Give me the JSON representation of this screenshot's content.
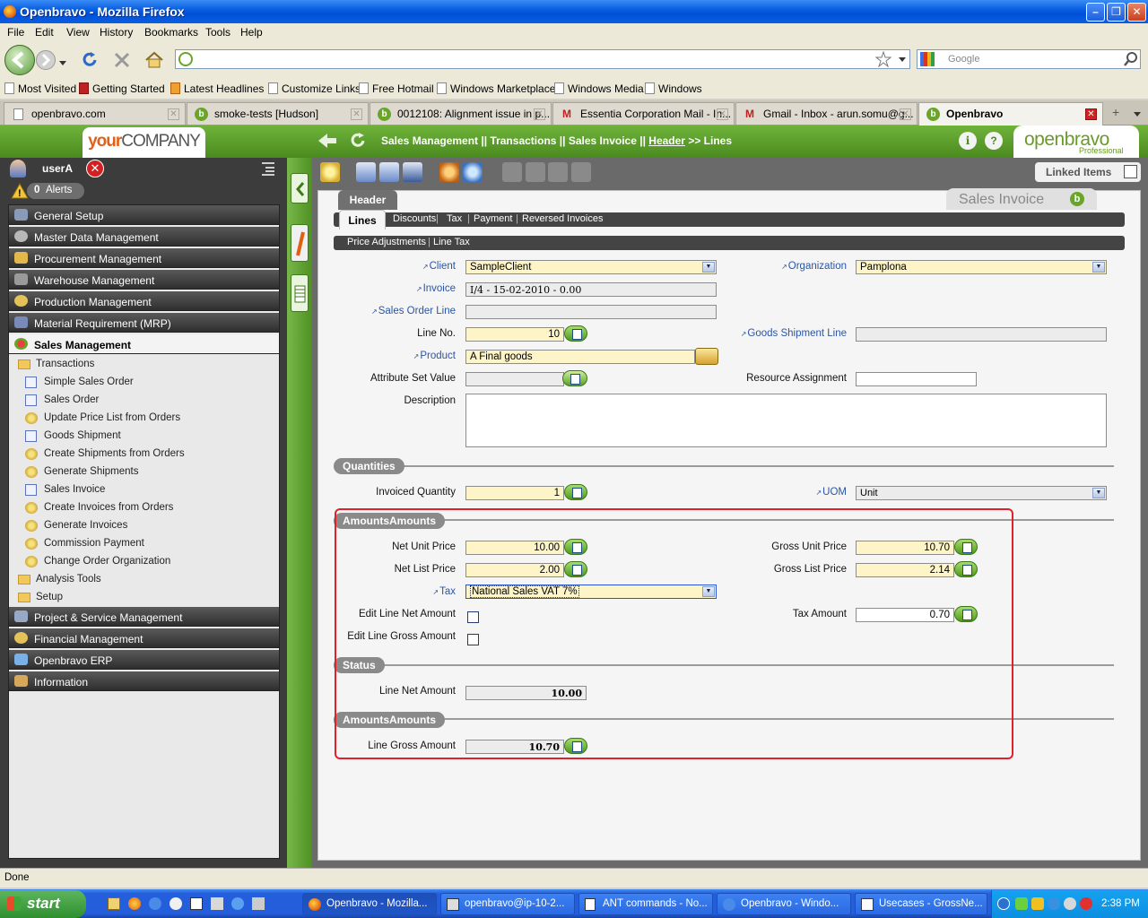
{
  "window": {
    "title": "Openbravo - Mozilla Firefox"
  },
  "menubar": [
    "File",
    "Edit",
    "View",
    "History",
    "Bookmarks",
    "Tools",
    "Help"
  ],
  "search": {
    "placeholder": "Google"
  },
  "bookmarks": [
    "Most Visited",
    "Getting Started",
    "Latest Headlines",
    "Customize Links",
    "Free Hotmail",
    "Windows Marketplace",
    "Windows Media",
    "Windows"
  ],
  "browser_tabs": [
    "openbravo.com",
    "smoke-tests [Hudson]",
    "0012108: Alignment issue in p...",
    "Essentia Corporation Mail - In...",
    "Gmail - Inbox - arun.somu@g...",
    "Openbravo"
  ],
  "app": {
    "logo_your": "your",
    "logo_company": "COMPANY",
    "brand": "openbravo",
    "brand_sub": "Professional",
    "breadcrumb": {
      "path": "Sales Management || Transactions || Sales Invoice ||",
      "header": "Header",
      "sep": ">>",
      "lines": "Lines"
    },
    "user": "userA",
    "alerts_count": "0",
    "alerts_label": "Alerts",
    "linked_items": "Linked Items",
    "form_title": "Sales Invoice"
  },
  "menu": {
    "sections_top": [
      "General Setup",
      "Master Data Management",
      "Procurement Management",
      "Warehouse Management",
      "Production Management",
      "Material Requirement (MRP)"
    ],
    "open_section": "Sales Management",
    "transactions": "Transactions",
    "items": [
      "Simple Sales Order",
      "Sales Order",
      "Update Price List from Orders",
      "Goods Shipment",
      "Create Shipments from Orders",
      "Generate Shipments",
      "Sales Invoice",
      "Create Invoices from Orders",
      "Generate Invoices",
      "Commission Payment",
      "Change Order Organization"
    ],
    "folders": [
      "Analysis Tools",
      "Setup"
    ],
    "sections_bottom": [
      "Project & Service Management",
      "Financial Management",
      "Openbravo ERP",
      "Information"
    ]
  },
  "tabs": {
    "header": "Header",
    "row1": [
      "Lines",
      "Discounts",
      "Tax",
      "Payment",
      "Reversed Invoices"
    ],
    "row2": [
      "Price Adjustments",
      "Line Tax"
    ]
  },
  "form": {
    "client_label": "Client",
    "client_value": "SampleClient",
    "org_label": "Organization",
    "org_value": "Pamplona",
    "invoice_label": "Invoice",
    "invoice_value": "I/4 - 15-02-2010 - 0.00",
    "sol_label": "Sales Order Line",
    "lineno_label": "Line No.",
    "lineno_value": "10",
    "gsl_label": "Goods Shipment Line",
    "product_label": "Product",
    "product_value": "A Final goods",
    "asv_label": "Attribute Set Value",
    "resource_label": "Resource Assignment",
    "desc_label": "Description",
    "quantities": "Quantities",
    "invqty_label": "Invoiced Quantity",
    "invqty_value": "1",
    "uom_label": "UOM",
    "uom_value": "Unit",
    "amounts": "AmountsAmounts",
    "nup_label": "Net Unit Price",
    "nup_value": "10.00",
    "gup_label": "Gross Unit Price",
    "gup_value": "10.70",
    "nlp_label": "Net List Price",
    "nlp_value": "2.00",
    "glp_label": "Gross List Price",
    "glp_value": "2.14",
    "tax_label": "Tax",
    "tax_value": "National Sales VAT 7%",
    "elna_label": "Edit Line Net Amount",
    "taxamt_label": "Tax Amount",
    "taxamt_value": "0.70",
    "elga_label": "Edit Line Gross Amount",
    "status": "Status",
    "lna_label": "Line Net Amount",
    "lna_value": "10.00",
    "amounts2": "AmountsAmounts",
    "lga_label": "Line Gross Amount",
    "lga_value": "10.70"
  },
  "statusbar": {
    "text": "Done"
  },
  "taskbar": {
    "start": "start",
    "tasks": [
      "Openbravo - Mozilla...",
      "openbravo@ip-10-2...",
      "ANT commands - No...",
      "Openbravo - Windo...",
      "Usecases - GrossNe..."
    ],
    "clock": "2:38 PM"
  }
}
